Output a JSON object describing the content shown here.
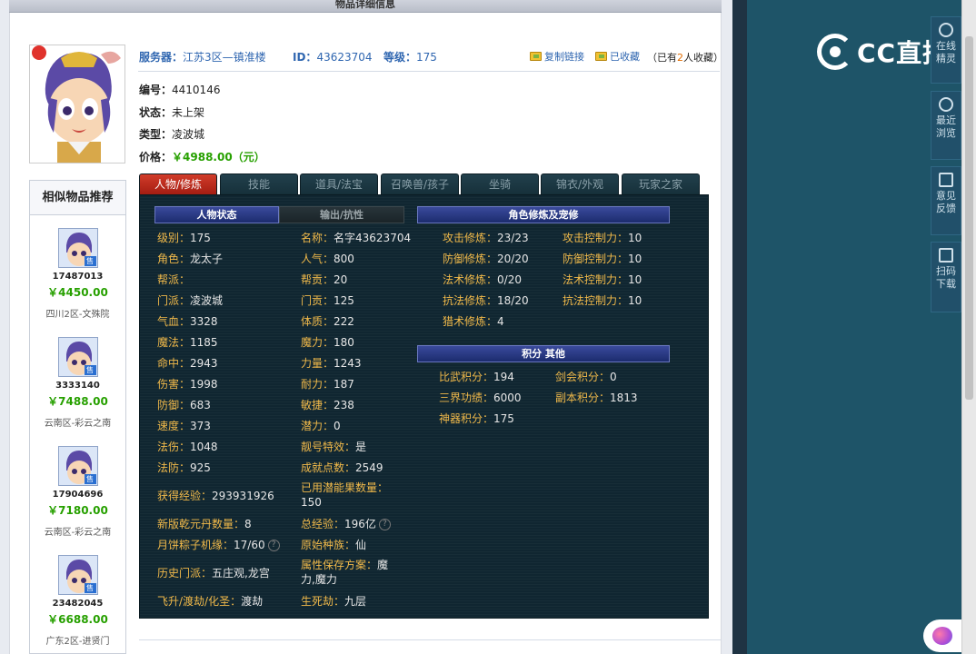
{
  "page": {
    "top_title": "物品详细信息"
  },
  "header": {
    "server_label": "服务器：",
    "server_value": "江苏3区—镇淮楼",
    "id_label": "ID：",
    "id_value": "43623704",
    "level_label": "等级：",
    "level_value": "175",
    "copy_link": "复制链接",
    "collected": "已收藏",
    "collect_prefix": "（已有",
    "collect_num": "2",
    "collect_suffix": "人收藏）"
  },
  "basic": {
    "number_label": "编号：",
    "number_value": "4410146",
    "status_label": "状态：",
    "status_value": "未上架",
    "type_label": "类型：",
    "type_value": "凌波城",
    "price_label": "价格：",
    "price_value": "￥4988.00（元）"
  },
  "similar": {
    "title": "相似物品推荐",
    "sale_tag": "售",
    "items": [
      {
        "id": "17487013",
        "price": "￥4450.00",
        "server": "四川2区-文殊院"
      },
      {
        "id": "3333140",
        "price": "￥7488.00",
        "server": "云南区-彩云之南"
      },
      {
        "id": "17904696",
        "price": "￥7180.00",
        "server": "云南区-彩云之南"
      },
      {
        "id": "23482045",
        "price": "￥6688.00",
        "server": "广东2区-进贤门"
      }
    ]
  },
  "tabs": [
    "人物/修炼",
    "技能",
    "道具/法宝",
    "召唤兽/孩子",
    "坐骑",
    "锦衣/外观",
    "玩家之家"
  ],
  "panel": {
    "head_status": "人物状态",
    "head_output": "输出/抗性",
    "head_cultivation": "角色修炼及宠修",
    "head_points": "积分 其他",
    "col1": [
      {
        "k": "级别：",
        "v": "175"
      },
      {
        "k": "角色：",
        "v": "龙太子"
      },
      {
        "k": "帮派：",
        "v": ""
      },
      {
        "k": "门派：",
        "v": "凌波城"
      },
      {
        "k": "气血：",
        "v": "3328"
      },
      {
        "k": "魔法：",
        "v": "1185"
      },
      {
        "k": "命中：",
        "v": "2943"
      },
      {
        "k": "伤害：",
        "v": "1998"
      },
      {
        "k": "防御：",
        "v": "683"
      },
      {
        "k": "速度：",
        "v": "373"
      },
      {
        "k": "法伤：",
        "v": "1048"
      },
      {
        "k": "法防：",
        "v": "925"
      }
    ],
    "col2": [
      {
        "k": "名称：",
        "v": "名字43623704"
      },
      {
        "k": "人气：",
        "v": "800"
      },
      {
        "k": "帮贡：",
        "v": "20"
      },
      {
        "k": "门贡：",
        "v": "125"
      },
      {
        "k": "体质：",
        "v": "222"
      },
      {
        "k": "魔力：",
        "v": "180"
      },
      {
        "k": "力量：",
        "v": "1243"
      },
      {
        "k": "耐力：",
        "v": "187"
      },
      {
        "k": "敏捷：",
        "v": "238"
      },
      {
        "k": "潜力：",
        "v": "0"
      },
      {
        "k": "靓号特效：",
        "v": "是"
      },
      {
        "k": "成就点数：",
        "v": "2549"
      }
    ],
    "exp_label": "获得经验：",
    "exp_value": "293931926",
    "used_fruit_label": "已用潜能果数量：",
    "used_fruit_value": "150",
    "dan_label": "新版乾元丹数量：",
    "dan_value": "8",
    "total_exp_label": "总经验：",
    "total_exp_value": "196亿",
    "zongzi_label": "月饼粽子机缘：",
    "zongzi_value": "17/60",
    "race_label": "原始种族：",
    "race_value": "仙",
    "history_label": "历史门派：",
    "history_value": "五庄观,龙宫",
    "attr_label": "属性保存方案：",
    "attr_value_1": "魔",
    "attr_value_2": "力,魔力",
    "fly_label": "飞升/渡劫/化圣：",
    "fly_value": "渡劫",
    "life_label": "生死劫：",
    "life_value": "九层",
    "question_mark": "?",
    "cultivation": [
      {
        "k": "攻击修炼：",
        "v": "23/23",
        "k2": "攻击控制力：",
        "v2": "10"
      },
      {
        "k": "防御修炼：",
        "v": "20/20",
        "k2": "防御控制力：",
        "v2": "10"
      },
      {
        "k": "法术修炼：",
        "v": "0/20",
        "k2": "法术控制力：",
        "v2": "10"
      },
      {
        "k": "抗法修炼：",
        "v": "18/20",
        "k2": "抗法控制力：",
        "v2": "10"
      },
      {
        "k": "猎术修炼：",
        "v": "4",
        "k2": "",
        "v2": ""
      }
    ],
    "points": [
      {
        "k": "比武积分：",
        "v": "194",
        "k2": "剑会积分：",
        "v2": "0"
      },
      {
        "k": "三界功绩：",
        "v": "6000",
        "k2": "副本积分：",
        "v2": "1813"
      },
      {
        "k": "神器积分：",
        "v": "175",
        "k2": "",
        "v2": ""
      }
    ]
  },
  "side": {
    "logo_text": "CC直播",
    "buttons": [
      {
        "line1": "在线",
        "line2": "精灵"
      },
      {
        "line1": "最近",
        "line2": "浏览"
      },
      {
        "line1": "意见",
        "line2": "反馈"
      },
      {
        "line1": "扫码",
        "line2": "下载"
      }
    ]
  }
}
